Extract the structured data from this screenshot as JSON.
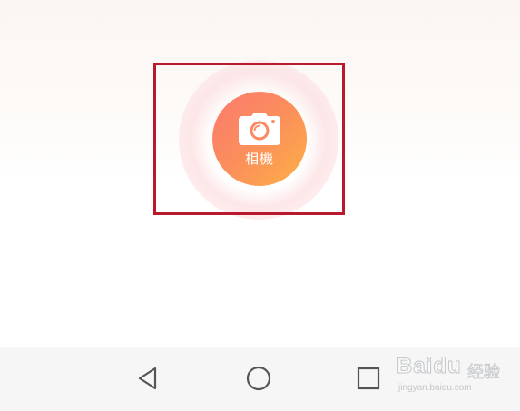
{
  "camera": {
    "label": "相機",
    "icon": "camera-icon"
  },
  "navigation": {
    "back_icon": "back-triangle-icon",
    "home_icon": "home-circle-icon",
    "recent_icon": "recent-square-icon"
  },
  "watermark": {
    "logo": "Baidu",
    "subtitle": "经验",
    "url": "jingyan.baidu.com"
  },
  "colors": {
    "highlight_border": "#b8192c",
    "button_gradient_start": "#fb7a6e",
    "button_gradient_end": "#fdb046",
    "nav_bar_bg": "#f6f6f6",
    "nav_icon": "#555555"
  }
}
